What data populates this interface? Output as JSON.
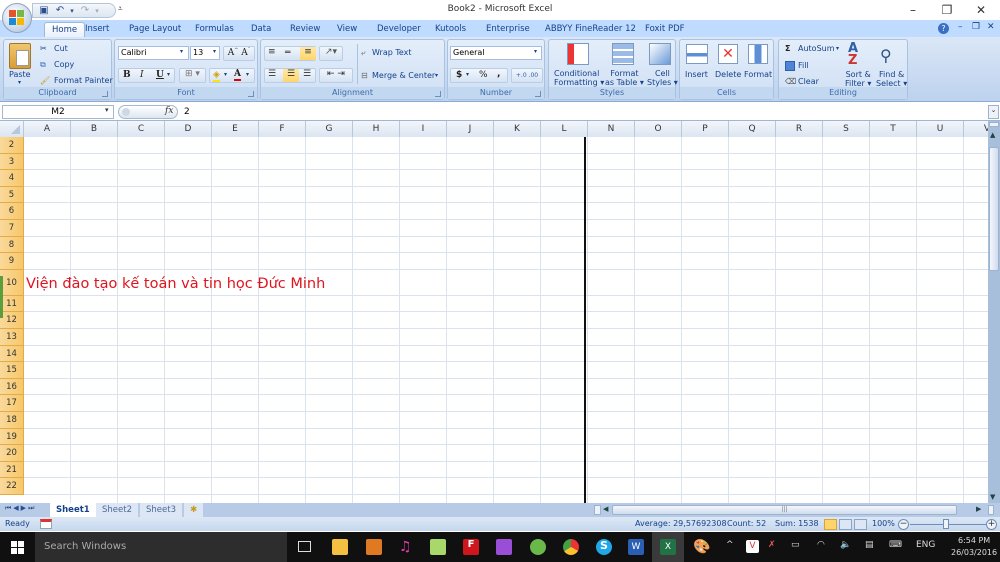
{
  "window": {
    "title": "Book2 - Microsoft Excel"
  },
  "quick_access": {
    "save": "save-icon",
    "undo": "undo-icon",
    "redo": "redo-icon"
  },
  "tabs": [
    "Home",
    "Insert",
    "Page Layout",
    "Formulas",
    "Data",
    "Review",
    "View",
    "Developer",
    "Kutools",
    "Enterprise",
    "ABBYY FineReader 12",
    "Foxit PDF"
  ],
  "active_tab": "Home",
  "ribbon": {
    "clipboard": {
      "label": "Clipboard",
      "paste": "Paste",
      "cut": "Cut",
      "copy": "Copy",
      "format_painter": "Format Painter"
    },
    "font": {
      "label": "Font",
      "font_name": "Calibri",
      "font_size": "13",
      "bold": "B",
      "italic": "I",
      "underline": "U"
    },
    "alignment": {
      "label": "Alignment",
      "wrap_text": "Wrap Text",
      "merge_center": "Merge & Center"
    },
    "number": {
      "label": "Number",
      "format": "General",
      "currency": "$",
      "percent": "%",
      "comma": ","
    },
    "styles": {
      "label": "Styles",
      "conditional1": "Conditional",
      "conditional2": "Formatting",
      "format_table1": "Format",
      "format_table2": "as Table",
      "cell_styles1": "Cell",
      "cell_styles2": "Styles"
    },
    "cells": {
      "label": "Cells",
      "insert": "Insert",
      "delete": "Delete",
      "format": "Format"
    },
    "editing": {
      "label": "Editing",
      "autosum": "AutoSum",
      "fill": "Fill",
      "clear": "Clear",
      "sort1": "Sort &",
      "sort2": "Filter",
      "find1": "Find &",
      "find2": "Select"
    }
  },
  "formula_bar": {
    "name_box": "M2",
    "fx": "fx",
    "value": "2"
  },
  "columns": [
    "A",
    "B",
    "C",
    "D",
    "E",
    "F",
    "G",
    "H",
    "I",
    "J",
    "K",
    "L",
    "N",
    "O",
    "P",
    "Q",
    "R",
    "S",
    "T",
    "U",
    "V"
  ],
  "rows": [
    "2",
    "3",
    "4",
    "5",
    "6",
    "7",
    "8",
    "9",
    "10",
    "11",
    "12",
    "13",
    "14",
    "15",
    "16",
    "17",
    "18",
    "19",
    "20",
    "21",
    "22"
  ],
  "cell_A10": "Viện đào tạo kế toán và tin học Đức Minh",
  "sheets": [
    "Sheet1",
    "Sheet2",
    "Sheet3"
  ],
  "active_sheet": "Sheet1",
  "status": {
    "ready": "Ready",
    "average": "Average: 29,57692308",
    "count": "Count: 52",
    "sum": "Sum: 1538",
    "zoom": "100%"
  },
  "taskbar": {
    "search_placeholder": "Search Windows",
    "language": "ENG",
    "time": "6:54 PM",
    "date": "26/03/2016"
  },
  "colors": {
    "cell_text": "#e0141e",
    "ribbon_text": "#15428b"
  }
}
